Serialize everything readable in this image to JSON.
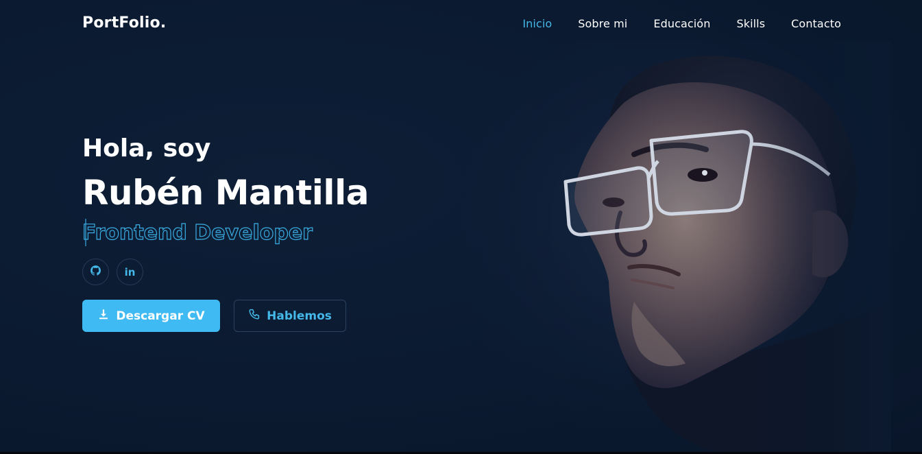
{
  "brand": {
    "logo": "PortFolio."
  },
  "nav": {
    "items": [
      {
        "label": "Inicio",
        "active": true
      },
      {
        "label": "Sobre mi",
        "active": false
      },
      {
        "label": "Educación",
        "active": false
      },
      {
        "label": "Skills",
        "active": false
      },
      {
        "label": "Contacto",
        "active": false
      }
    ]
  },
  "hero": {
    "greeting": "Hola, soy",
    "name": "Rubén Mantilla",
    "role": "Frontend Developer",
    "social": [
      {
        "icon": "github-icon"
      },
      {
        "icon": "linkedin-icon",
        "label": "in"
      }
    ],
    "download_label": "Descargar CV",
    "contact_label": "Hablemos"
  },
  "colors": {
    "accent": "#40baf2",
    "background": "#0b1a30",
    "nav_active": "#44b8e8"
  }
}
